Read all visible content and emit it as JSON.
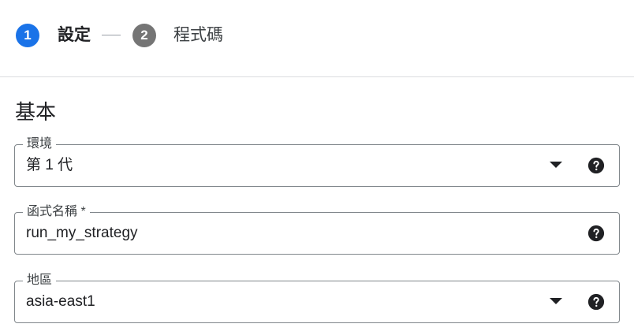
{
  "stepper": {
    "steps": [
      {
        "number": "1",
        "label": "設定",
        "state": "active"
      },
      {
        "number": "2",
        "label": "程式碼",
        "state": "inactive"
      }
    ],
    "active_color": "#1a73e8",
    "inactive_color": "#757575"
  },
  "section": {
    "title": "基本"
  },
  "fields": {
    "environment": {
      "label": "環境",
      "value": "第 1 代",
      "type": "select",
      "help_icon": "help-circle-icon"
    },
    "function_name": {
      "label": "函式名稱 *",
      "value": "run_my_strategy",
      "type": "text",
      "help_icon": "help-circle-icon"
    },
    "region": {
      "label": "地區",
      "value": "asia-east1",
      "type": "select",
      "help_icon": "help-circle-icon"
    }
  }
}
